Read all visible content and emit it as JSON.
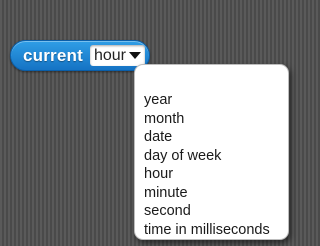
{
  "block": {
    "label": "current",
    "selected_value": "hour",
    "color": "#1e88d6",
    "arrow_icon": "triangle-down-icon"
  },
  "menu": {
    "items": [
      {
        "label": "year"
      },
      {
        "label": "month"
      },
      {
        "label": "date"
      },
      {
        "label": "day of week"
      },
      {
        "label": "hour"
      },
      {
        "label": "minute"
      },
      {
        "label": "second"
      },
      {
        "label": "time in milliseconds"
      }
    ]
  }
}
